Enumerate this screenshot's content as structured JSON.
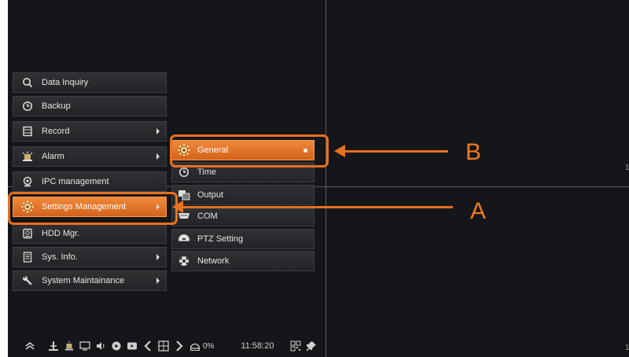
{
  "colors": {
    "accent_orange": "#e8701e",
    "background": "#151619",
    "menu_item_bg": "#2b2d30",
    "text": "#e6e6e6"
  },
  "main_menu": {
    "items": [
      {
        "label": "Data Inquiry",
        "icon": "search-icon",
        "has_submenu": false,
        "active": false
      },
      {
        "label": "Backup",
        "icon": "clock-icon",
        "has_submenu": false,
        "active": false
      },
      {
        "label": "Record",
        "icon": "film-icon",
        "has_submenu": true,
        "active": false
      },
      {
        "label": "Alarm",
        "icon": "alarm-icon",
        "has_submenu": true,
        "active": false
      },
      {
        "label": "IPC management",
        "icon": "camera-icon",
        "has_submenu": false,
        "active": false
      },
      {
        "label": "Settings Management",
        "icon": "gear-icon",
        "has_submenu": true,
        "active": true
      },
      {
        "label": "HDD Mgr.",
        "icon": "hdd-icon",
        "has_submenu": false,
        "active": false
      },
      {
        "label": "Sys. Info.",
        "icon": "document-icon",
        "has_submenu": true,
        "active": false
      },
      {
        "label": "System Maintainance",
        "icon": "wrench-icon",
        "has_submenu": true,
        "active": false
      }
    ]
  },
  "submenu": {
    "items": [
      {
        "label": "General",
        "icon": "gear-icon",
        "active": true
      },
      {
        "label": "Time",
        "icon": "clock-icon",
        "active": false
      },
      {
        "label": "Output",
        "icon": "output-icon",
        "active": false
      },
      {
        "label": "COM",
        "icon": "com-port-icon",
        "active": false
      },
      {
        "label": "PTZ Setting",
        "icon": "ptz-camera-icon",
        "active": false
      },
      {
        "label": "Network",
        "icon": "network-icon",
        "active": false
      }
    ]
  },
  "callouts": {
    "a": "A",
    "b": "B"
  },
  "taskbar": {
    "icons": [
      "home-icon",
      "tree-icon",
      "alarm-icon",
      "screen-icon",
      "volume-icon",
      "playback-icon",
      "record-icon",
      "prev-icon",
      "grid-icon",
      "next-icon",
      "hdd-icon"
    ],
    "hdd_usage": "0%",
    "time": "11:58:20",
    "right_icons": [
      "qr-code-icon",
      "pin-icon"
    ]
  },
  "edge_marks": [
    "1",
    "1"
  ]
}
